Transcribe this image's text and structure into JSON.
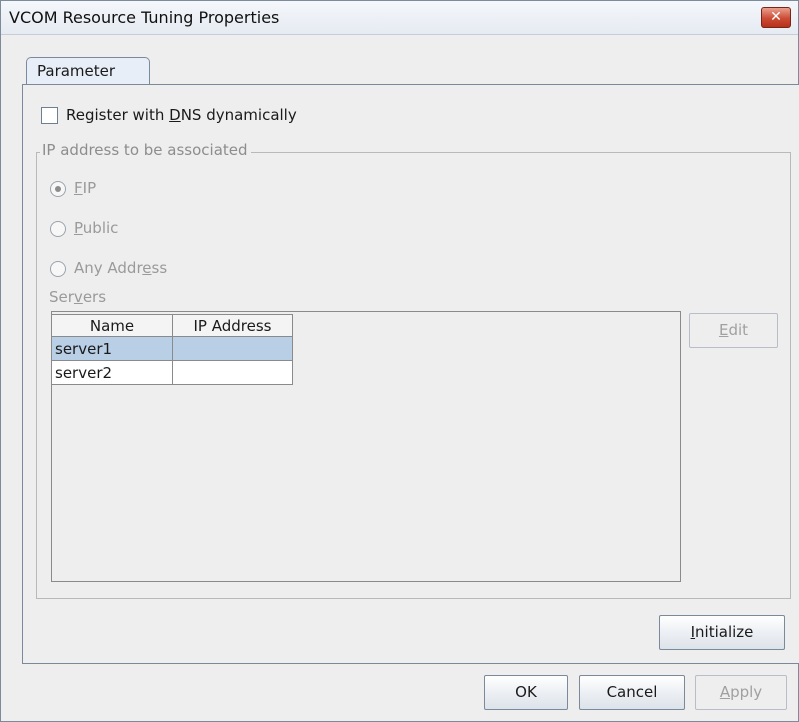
{
  "window": {
    "title": "VCOM Resource Tuning Properties",
    "close_symbol": "✕"
  },
  "tabs": [
    {
      "label": "Parameter",
      "selected": true
    }
  ],
  "register_dns": {
    "label_pre": "Register with ",
    "label_mn": "D",
    "label_post": "NS dynamically",
    "checked": false
  },
  "ip_group": {
    "title": "IP address to be associated",
    "options": [
      {
        "pre": "",
        "mn": "F",
        "post": "IP",
        "selected": true
      },
      {
        "pre": "",
        "mn": "P",
        "post": "ublic",
        "selected": false
      },
      {
        "pre": "Any Addr",
        "mn": "e",
        "post": "ss",
        "selected": false
      }
    ]
  },
  "servers": {
    "label_pre": "Ser",
    "label_mn": "v",
    "label_post": "ers",
    "columns": [
      "Name",
      "IP Address"
    ],
    "rows": [
      {
        "name": "server1",
        "ip": "",
        "selected": true
      },
      {
        "name": "server2",
        "ip": "",
        "selected": false
      }
    ]
  },
  "buttons": {
    "edit": {
      "mn": "E",
      "post": "dit"
    },
    "initialize": {
      "mn": "I",
      "post": "nitialize"
    },
    "ok": "OK",
    "cancel": "Cancel",
    "apply": {
      "mn": "A",
      "post": "pply"
    }
  }
}
